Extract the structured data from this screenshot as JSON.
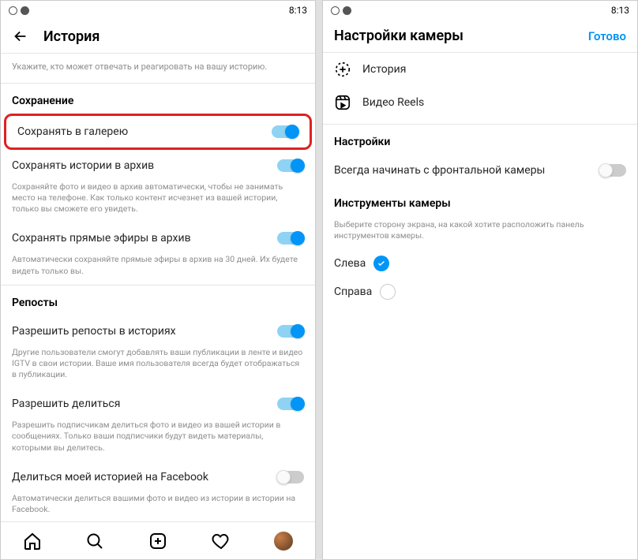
{
  "time": "8:13",
  "left": {
    "title": "История",
    "subtitle": "Укажите, кто может отвечать и реагировать на вашу историю.",
    "section_save": "Сохранение",
    "save_gallery": "Сохранять в галерею",
    "save_archive": "Сохранять истории в архив",
    "save_archive_desc": "Сохраняйте фото и видео в архив автоматически, чтобы не занимать место на телефоне. Как только контент исчезнет из вашей истории, только вы сможете его увидеть.",
    "save_live": "Сохранять прямые эфиры в архив",
    "save_live_desc": "Автоматически сохраняйте прямые эфиры в архив на 30 дней. Их будете видеть только вы.",
    "section_repost": "Репосты",
    "repost_stories": "Разрешить репосты в историях",
    "repost_stories_desc": "Другие пользователи смогут добавлять ваши публикации в ленте и видео IGTV в свои истории. Ваше имя пользователя всегда будет отображаться в публикации.",
    "allow_share": "Разрешить делиться",
    "allow_share_desc": "Разрешить подписчикам делиться фото и видео из вашей истории в сообщениях. Только ваши подписчики будут видеть материалы, которыми вы делитесь.",
    "share_fb": "Делиться моей историей на Facebook",
    "share_fb_desc": "Автоматически делиться вашими фото и видео из истории в истории на Facebook."
  },
  "right": {
    "title": "Настройки камеры",
    "done": "Готово",
    "nav_history": "История",
    "nav_reels": "Видео Reels",
    "section_settings": "Настройки",
    "front_camera": "Всегда начинать с фронтальной камеры",
    "section_tools": "Инструменты камеры",
    "tools_desc": "Выберите сторону экрана, на какой хотите расположить панель инструментов камеры.",
    "opt_left": "Слева",
    "opt_right": "Справа"
  }
}
